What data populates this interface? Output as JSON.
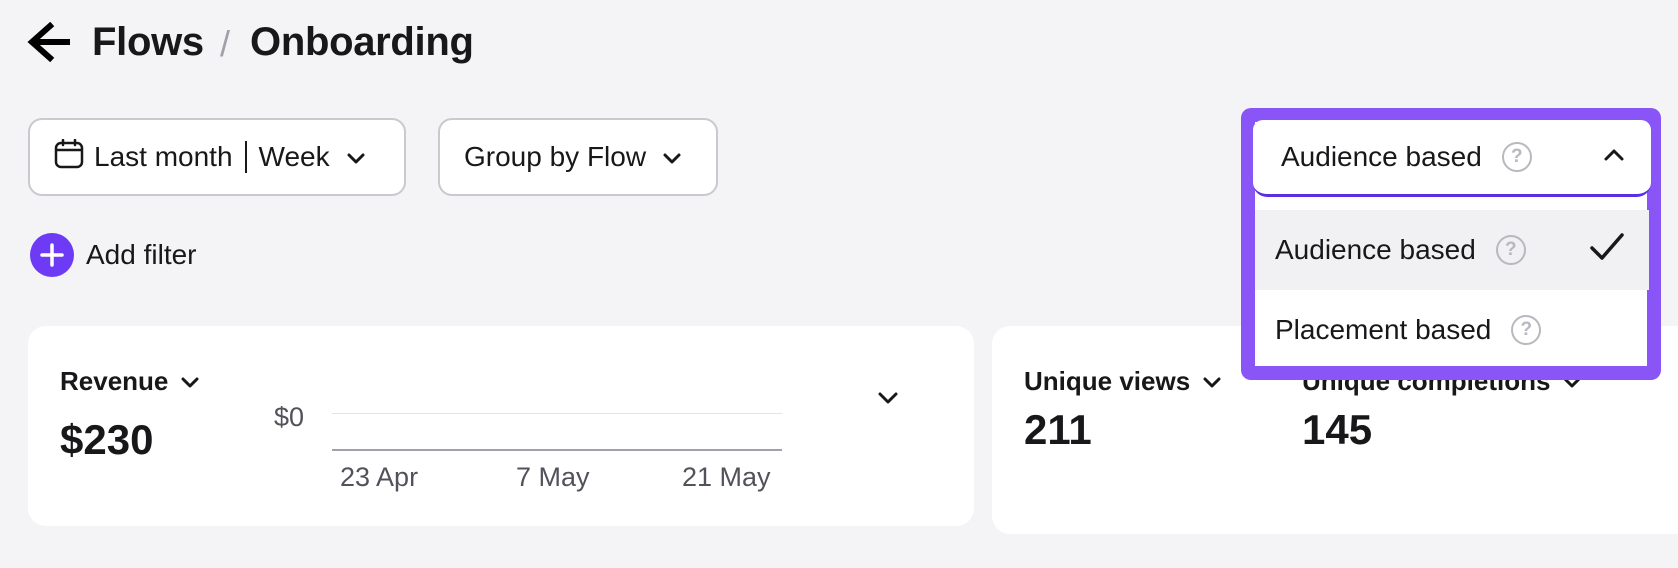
{
  "breadcrumb": {
    "parent": "Flows",
    "separator": "/",
    "current": "Onboarding"
  },
  "filters": {
    "date_range": "Last month",
    "interval": "Week",
    "group_by": "Group by Flow",
    "add_filter": "Add filter"
  },
  "attribution": {
    "selected": "Audience based",
    "options": [
      {
        "label": "Audience based",
        "selected": true
      },
      {
        "label": "Placement based",
        "selected": false
      }
    ]
  },
  "revenue_card": {
    "title": "Revenue",
    "value": "$230",
    "chart_data": {
      "type": "line",
      "x_ticks": [
        "23 Apr",
        "7 May",
        "21 May"
      ],
      "y_ticks": [
        "$0"
      ],
      "series": []
    }
  },
  "metrics": [
    {
      "title": "Unique views",
      "value": "211"
    },
    {
      "title": "Unique completions",
      "value": "145"
    }
  ],
  "colors": {
    "accent": "#6d3bf5",
    "dropdown_border": "#8a55f7"
  }
}
